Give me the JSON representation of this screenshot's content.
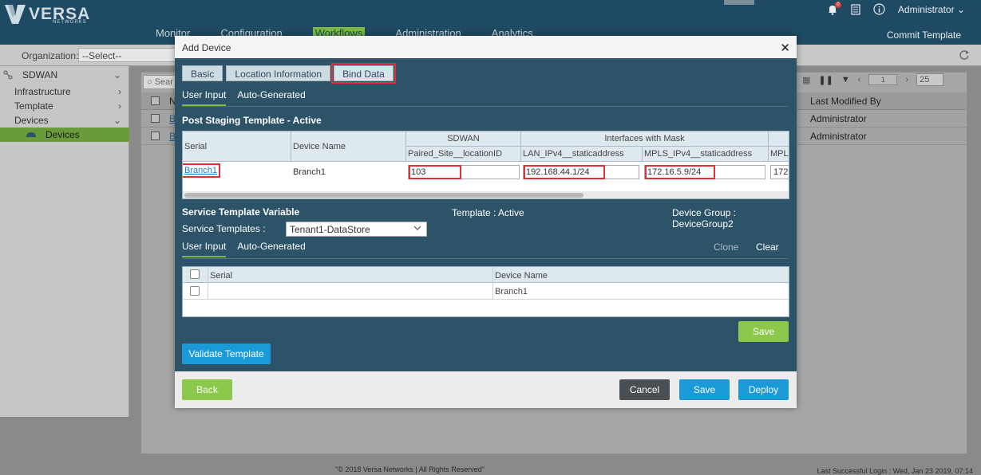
{
  "app": {
    "logo_text": "VERSA",
    "logo_sub": "NETWORKS",
    "nav": [
      "Monitor",
      "Configuration",
      "Workflows",
      "Administration",
      "Analytics"
    ],
    "active_nav": "Workflows",
    "commit_label": "Commit Template",
    "user_label": "Administrator",
    "notification_count": "0",
    "org_label": "Organization:",
    "org_value": "--Select--"
  },
  "sidebar": {
    "root": "SDWAN",
    "items": [
      {
        "label": "Infrastructure"
      },
      {
        "label": "Template"
      },
      {
        "label": "Devices"
      },
      {
        "label": "Devices"
      }
    ]
  },
  "grid": {
    "search_placeholder": "Sear",
    "col_name_partial": "N",
    "col_last_modified": "Last Modified By",
    "rows": [
      {
        "link_partial": "B",
        "last_modified": "Administrator"
      },
      {
        "link_partial": "B",
        "last_modified": "Administrator"
      }
    ],
    "page": "1",
    "page_size": "25"
  },
  "footer": {
    "copyright": "\"© 2018 Versa Networks | All Rights Reserved\"",
    "last_login": "Last Successful Login : Wed, Jan 23 2019, 07:14"
  },
  "modal": {
    "title": "Add Device",
    "tabs": [
      "Basic",
      "Location Information",
      "Bind Data"
    ],
    "subtabs": [
      "User Input",
      "Auto-Generated"
    ],
    "post_staging": {
      "title": "Post Staging Template - Active",
      "group_sdwan": "SDWAN",
      "group_interfaces": "Interfaces with Mask",
      "col_serial": "Serial",
      "col_device_name": "Device Name",
      "col_paired_site": "Paired_Site__locationID",
      "col_lan": "LAN_IPv4__staticaddress",
      "col_mpls": "MPLS_IPv4__staticaddress",
      "col_mpls_partial": "MPLS",
      "row": {
        "serial": "Branch1",
        "device_name": "Branch1",
        "paired_site": "103",
        "lan": "192.168.44.1/24",
        "mpls": "172.16.5.9/24",
        "mpls_partial": "172."
      }
    },
    "service": {
      "title": "Service Template Variable",
      "template_status": "Template : Active",
      "device_group": "Device Group : DeviceGroup2",
      "templates_label": "Service Templates :",
      "templates_value": "Tenant1-DataStore",
      "subtabs": [
        "User Input",
        "Auto-Generated"
      ],
      "clone_label": "Clone",
      "clear_label": "Clear",
      "col_serial": "Serial",
      "col_device_name": "Device Name",
      "row": {
        "serial": "",
        "device_name": "Branch1"
      },
      "save_label": "Save"
    },
    "validate_label": "Validate Template",
    "footer": {
      "back": "Back",
      "cancel": "Cancel",
      "save": "Save",
      "deploy": "Deploy"
    }
  }
}
